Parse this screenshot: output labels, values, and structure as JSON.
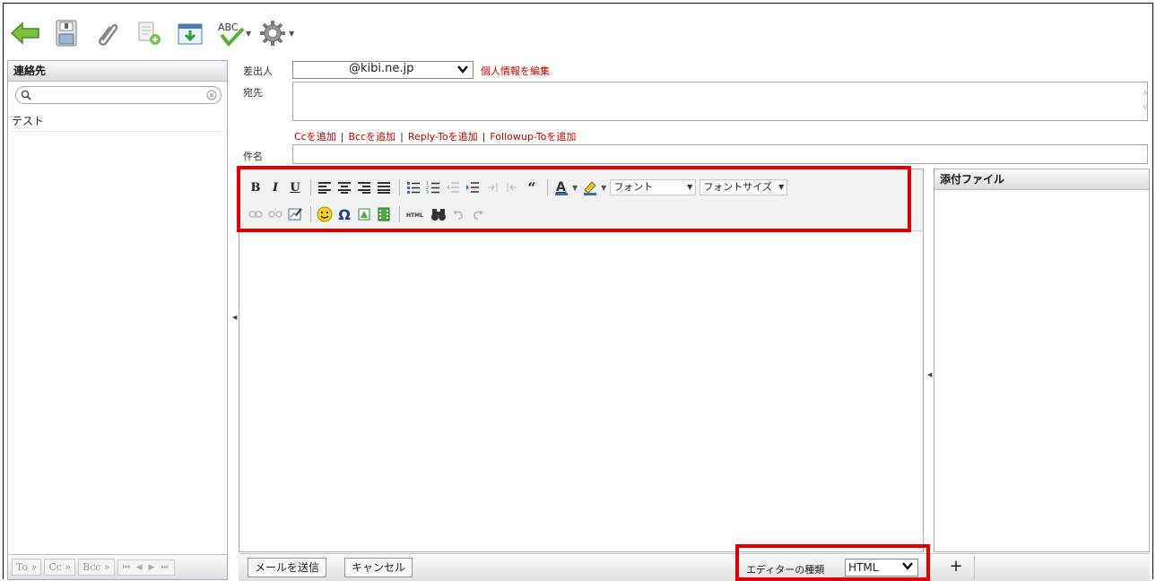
{
  "toolbar": {
    "back_icon": "arrow-left-icon",
    "save_icon": "floppy-save-icon",
    "attach_icon": "paperclip-icon",
    "sign_icon": "signature-icon",
    "draft_icon": "download-draft-icon",
    "spell_label": "ABC",
    "settings_icon": "gear-icon"
  },
  "contacts": {
    "title": "連絡先",
    "search_placeholder": "",
    "items": [
      {
        "label": "テスト"
      }
    ],
    "footer": {
      "to": "To »",
      "cc": "Cc »",
      "bcc": "Bcc »",
      "nav": "⏮ ◀ ▶ ⏭"
    }
  },
  "compose": {
    "from_label": "差出人",
    "from_value": "@kibi.ne.jp",
    "edit_identity": "個人情報を編集",
    "to_label": "宛先",
    "add_cc": "Ccを追加",
    "add_bcc": "Bccを追加",
    "add_reply_to": "Reply-Toを追加",
    "add_followup_to": "Followup-Toを追加",
    "subject_label": "件名"
  },
  "editor": {
    "bold": "B",
    "italic": "I",
    "underline": "U",
    "font_label": "フォント",
    "font_size_label": "フォントサイズ",
    "html_label": "HTML"
  },
  "attachments": {
    "title": "添付ファイル",
    "add": "+"
  },
  "bottom": {
    "send": "メールを送信",
    "cancel": "キャンセル",
    "editor_type_label": "エディターの種類",
    "editor_type_value": "HTML"
  },
  "colors": {
    "highlight": "#e00000",
    "link": "#c00000"
  }
}
